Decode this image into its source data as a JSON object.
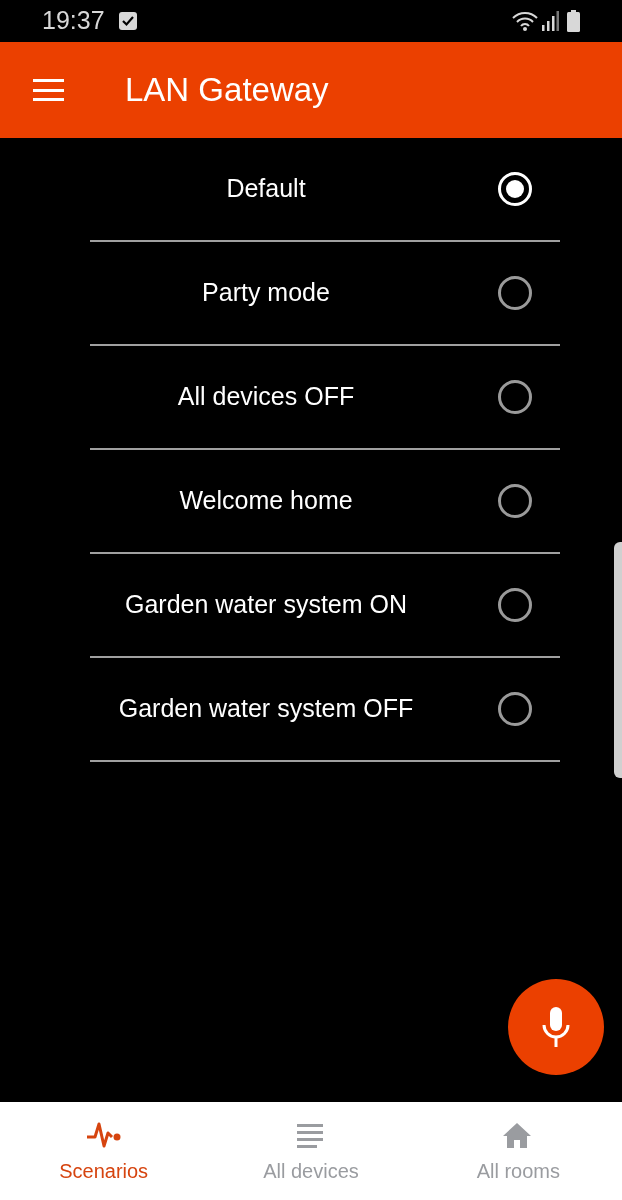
{
  "status_bar": {
    "time": "19:37"
  },
  "app_bar": {
    "title": "LAN Gateway"
  },
  "scenarios": [
    {
      "label": "Default",
      "selected": true
    },
    {
      "label": "Party mode",
      "selected": false
    },
    {
      "label": "All devices OFF",
      "selected": false
    },
    {
      "label": "Welcome home",
      "selected": false
    },
    {
      "label": "Garden water system ON",
      "selected": false
    },
    {
      "label": "Garden water system OFF",
      "selected": false
    }
  ],
  "bottom_nav": [
    {
      "kind": "pulse",
      "label": "Scenarios",
      "selected": true
    },
    {
      "kind": "list",
      "label": "All devices",
      "selected": false
    },
    {
      "kind": "home",
      "label": "All rooms",
      "selected": false
    }
  ]
}
